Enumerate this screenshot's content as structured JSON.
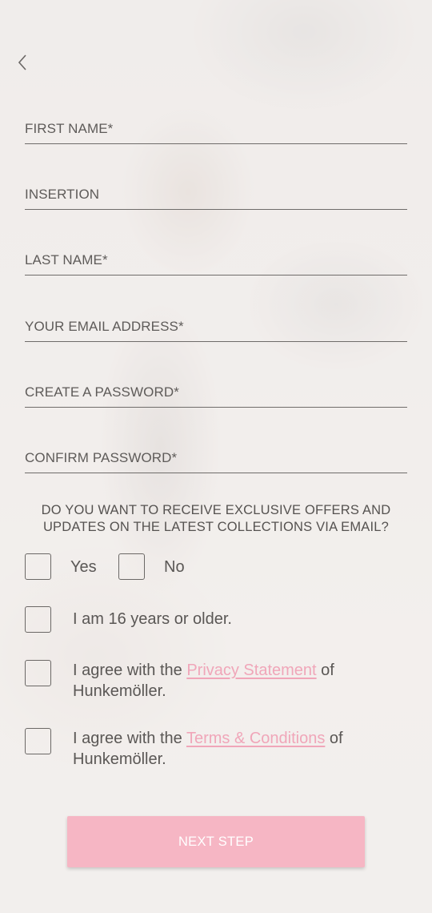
{
  "navigation": {
    "back_icon": "chevron-left-icon"
  },
  "form": {
    "fields": [
      {
        "key": "first_name",
        "placeholder": "FIRST NAME*",
        "value": ""
      },
      {
        "key": "insertion",
        "placeholder": "INSERTION",
        "value": ""
      },
      {
        "key": "last_name",
        "placeholder": "LAST NAME*",
        "value": ""
      },
      {
        "key": "email",
        "placeholder": "YOUR EMAIL ADDRESS*",
        "value": ""
      },
      {
        "key": "password",
        "placeholder": "CREATE A PASSWORD*",
        "value": ""
      },
      {
        "key": "confirm_password",
        "placeholder": "CONFIRM PASSWORD*",
        "value": ""
      }
    ],
    "offers_question": "DO YOU WANT TO RECEIVE EXCLUSIVE OFFERS AND UPDATES ON THE LATEST COLLECTIONS VIA EMAIL?",
    "offers_options": {
      "yes": "Yes",
      "no": "No"
    },
    "age_confirmation": "I am 16 years or older.",
    "privacy": {
      "prefix": "I agree with the ",
      "link": "Privacy Statement",
      "suffix": " of Hunkemöller."
    },
    "terms": {
      "prefix": "I agree with the ",
      "link": "Terms & Conditions",
      "suffix": " of Hunkemöller."
    },
    "submit_label": "NEXT STEP"
  },
  "colors": {
    "accent_pink": "#f6b6c4",
    "link_pink": "#f0a6b9",
    "text_gray": "#5a5755"
  }
}
